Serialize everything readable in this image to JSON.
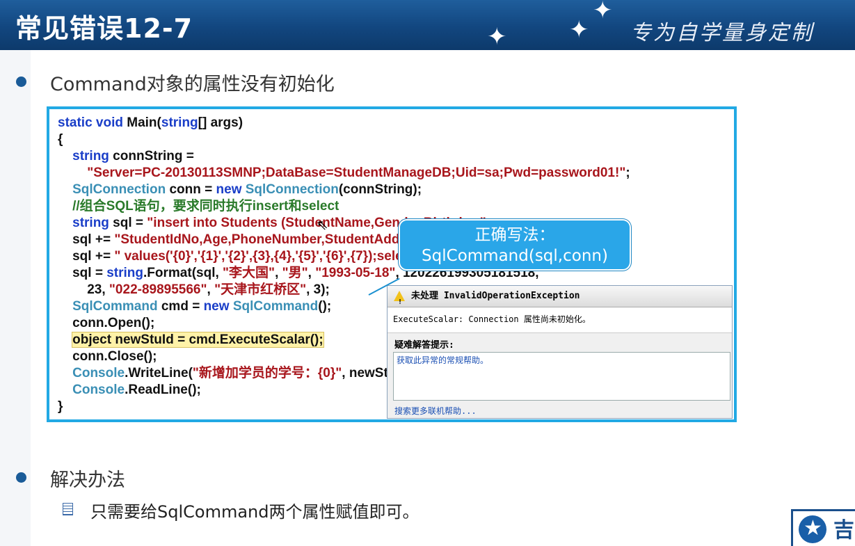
{
  "header": {
    "title": "常见错误12-7",
    "slogan": "专为自学量身定制"
  },
  "bullets": [
    {
      "text": "Command对象的属性没有初始化"
    },
    {
      "text": "解决办法"
    }
  ],
  "sub_bullet": {
    "text": "只需要给SqlCommand两个属性赋值即可。"
  },
  "callout": {
    "line1": "正确写法：",
    "line2": "SqlCommand(sql,conn)"
  },
  "dialog": {
    "title": "未处理 InvalidOperationException",
    "message": "ExecuteScalar: Connection 属性尚未初始化。",
    "tip_label": "疑难解答提示:",
    "tip_link": "获取此异常的常规帮助。",
    "more_help": "搜索更多联机帮助..."
  },
  "logo": {
    "char": "吉"
  },
  "code_lines": [
    "static void Main(string[] args)",
    "{",
    "string connString =",
    "\"Server=PC-20130113SMNP;DataBase=StudentManageDB;Uid=sa;Pwd=password01!\";",
    "SqlConnection conn = new SqlConnection(connString);",
    "//组合SQL语句，要求同时执行insert和select",
    "string sql = \"insert into Students (StudentName,Gender,Birthday,\";",
    "sql += \"StudentIdNo,Age,PhoneNumber,StudentAddress,ClassId)\";",
    "sql += \" values('{0}','{1}','{2}',{3},{4},'{5}','{6}',{7});select @@identity\";",
    "sql = string.Format(sql, \"李大国\", \"男\", \"1993-05-18\", 120226199305181518,",
    "23, \"022-89895566\", \"天津市红桥区\", 3);",
    "SqlCommand cmd = new SqlCommand();",
    "conn.Open();",
    "object newStuId = cmd.ExecuteScalar();",
    "conn.Close();",
    "Console.WriteLine(\"新增加学员的学号：{0}\", newStuId);",
    "Console.ReadLine();",
    "}"
  ]
}
